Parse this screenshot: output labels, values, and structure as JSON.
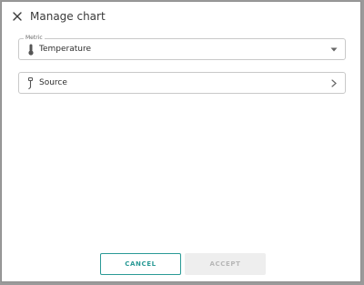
{
  "dialog": {
    "title": "Manage chart",
    "close_icon": "close-icon"
  },
  "metric": {
    "label": "Metric",
    "value": "Temperature",
    "icon": "thermometer-icon",
    "end_icon": "caret-down-icon"
  },
  "source": {
    "value": "Source",
    "icon": "sensor-probe-icon",
    "end_icon": "chevron-right-icon"
  },
  "actions": {
    "cancel_label": "CANCEL",
    "accept_label": "ACCEPT"
  },
  "colors": {
    "accent": "#2a9a96",
    "disabled_bg": "#eeeeee",
    "disabled_text": "#b7b7b7"
  }
}
